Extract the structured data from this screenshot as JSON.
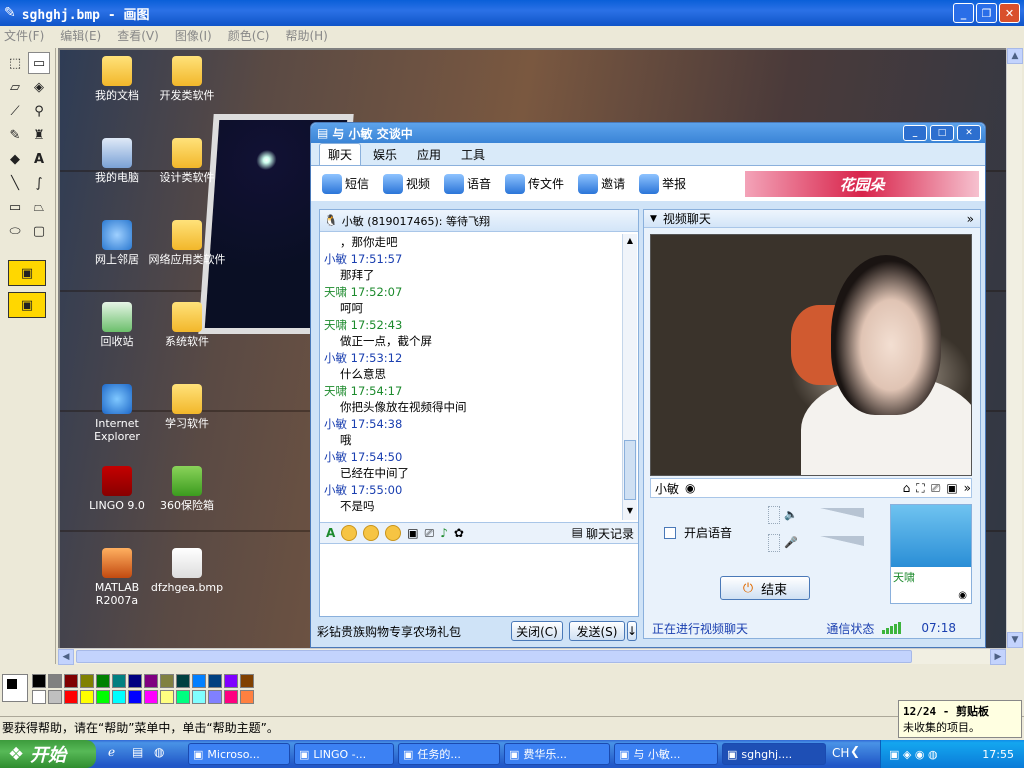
{
  "paint": {
    "title": "sghghj.bmp - 画图",
    "menu": [
      "文件(F)",
      "编辑(E)",
      "查看(V)",
      "图像(I)",
      "颜色(C)",
      "帮助(H)"
    ],
    "status_text": "要获得帮助，请在“帮助”菜单中，单击“帮助主题”。"
  },
  "desktop_icons": [
    {
      "label": "我的文档",
      "icon": "my-documents-icon"
    },
    {
      "label": "开发类软件",
      "icon": "folder-icon"
    },
    {
      "label": "我的电脑",
      "icon": "my-computer-icon"
    },
    {
      "label": "设计类软件",
      "icon": "folder-icon"
    },
    {
      "label": "网上邻居",
      "icon": "network-icon"
    },
    {
      "label": "网络应用类软件",
      "icon": "folder-icon"
    },
    {
      "label": "回收站",
      "icon": "recycle-bin-icon"
    },
    {
      "label": "系统软件",
      "icon": "folder-icon"
    },
    {
      "label": "Internet Explorer",
      "icon": "ie-icon"
    },
    {
      "label": "学习软件",
      "icon": "folder-icon"
    },
    {
      "label": "LINGO 9.0",
      "icon": "lingo-icon"
    },
    {
      "label": "360保险箱",
      "icon": "safe-icon"
    },
    {
      "label": "MATLAB R2007a",
      "icon": "matlab-icon"
    },
    {
      "label": "dfzhgea.bmp",
      "icon": "bmp-file-icon"
    }
  ],
  "qq": {
    "title": "与 小敏 交谈中",
    "tabs": [
      "聊天",
      "娱乐",
      "应用",
      "工具"
    ],
    "toolbar": [
      "短信",
      "视频",
      "语音",
      "传文件",
      "邀请",
      "举报"
    ],
    "chat_header": "小敏 (819017465): 等待飞翔",
    "messages": [
      {
        "type": "body",
        "text": "，那你走吧"
      },
      {
        "type": "head",
        "who": "x",
        "text": "小敏  17:51:57"
      },
      {
        "type": "body",
        "text": "那拜了"
      },
      {
        "type": "head",
        "who": "t",
        "text": "天啸  17:52:07"
      },
      {
        "type": "body",
        "text": "呵呵"
      },
      {
        "type": "head",
        "who": "t",
        "text": "天啸  17:52:43"
      },
      {
        "type": "body",
        "text": "做正一点，截个屏"
      },
      {
        "type": "head",
        "who": "x",
        "text": "小敏  17:53:12"
      },
      {
        "type": "body",
        "text": "什么意思"
      },
      {
        "type": "head",
        "who": "t",
        "text": "天啸  17:54:17"
      },
      {
        "type": "body",
        "text": "你把头像放在视频得中间"
      },
      {
        "type": "head",
        "who": "x",
        "text": "小敏  17:54:38"
      },
      {
        "type": "body",
        "text": "哦"
      },
      {
        "type": "head",
        "who": "x",
        "text": "小敏  17:54:50"
      },
      {
        "type": "body",
        "text": "已经在中间了"
      },
      {
        "type": "head",
        "who": "x",
        "text": "小敏  17:55:00"
      },
      {
        "type": "body",
        "text": "不是吗"
      }
    ],
    "history_label": "聊天记录",
    "ad_text": "彩钻贵族购物专享农场礼包",
    "close_label": "关闭(C)",
    "send_label": "发送(S)",
    "video_header": "视频聊天",
    "remote_name": "小敏",
    "voice_label": "开启语音",
    "local_name": "天啸",
    "end_label": "结束",
    "video_status": "正在进行视频聊天",
    "net_label": "通信状态",
    "duration": "07:18"
  },
  "clipboard": {
    "title": "12/24 - 剪贴板",
    "text": "未收集的项目。"
  },
  "taskbar": {
    "start": "开始",
    "buttons": [
      "Microso...",
      "LINGO -...",
      "任务的...",
      "费华乐...",
      "与 小敏...",
      "sghghj...."
    ],
    "lang": "CH",
    "clock": "17:55"
  }
}
